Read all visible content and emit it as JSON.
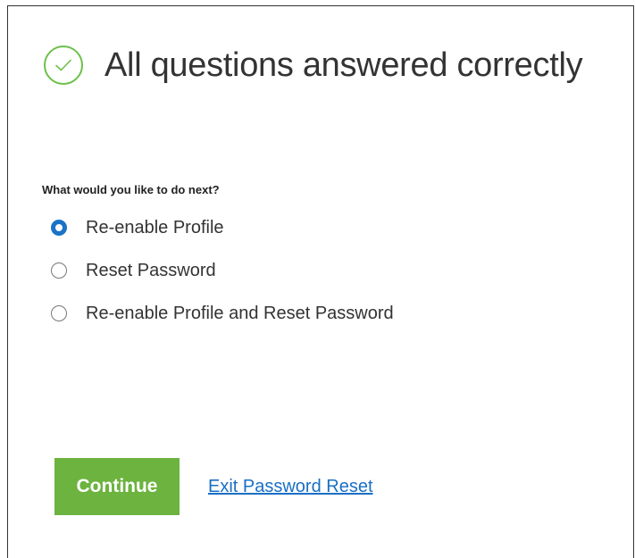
{
  "header": {
    "icon": "checkmark-circle-icon",
    "title": "All questions answered correctly",
    "accent_color": "#6cc04a"
  },
  "form": {
    "question": "What would you like to do next?",
    "selected": "Re-enable Profile",
    "options": [
      {
        "label": "Re-enable Profile",
        "checked": true
      },
      {
        "label": "Reset Password",
        "checked": false
      },
      {
        "label": "Re-enable Profile and Reset Password",
        "checked": false
      }
    ]
  },
  "actions": {
    "continue_label": "Continue",
    "continue_color": "#6cb33f",
    "exit_label": "Exit Password Reset",
    "link_color": "#1a6fc4"
  }
}
